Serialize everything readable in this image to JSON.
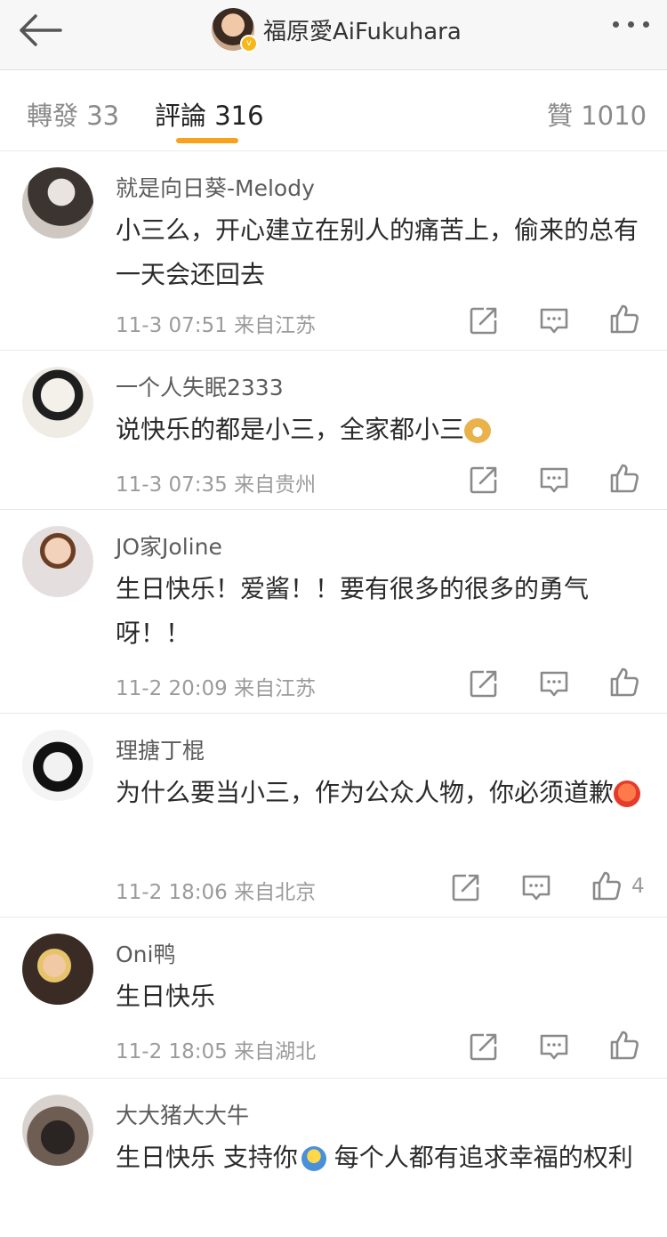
{
  "header": {
    "title": "福原愛AiFukuhara",
    "icons": {
      "back": "back-arrow-icon",
      "more": "more-dots-icon",
      "verified": "verified-badge-icon"
    }
  },
  "tabs": [
    {
      "label": "轉發 33"
    },
    {
      "label": "評論 316"
    },
    {
      "label": "贊 1010"
    }
  ],
  "accent_color": "#f7a21a",
  "comments": [
    {
      "name": "就是向日葵-Melody",
      "text": "小三么，开心建立在别人的痛苦上，偷来的总有一天会还回去",
      "time": "11-3 07:51",
      "source": "来自江苏",
      "likes": ""
    },
    {
      "name": "一个人失眠2333",
      "text": "说快乐的都是小三，全家都小三",
      "emoji": "doge-emoji",
      "time": "11-3 07:35",
      "source": "来自贵州",
      "likes": ""
    },
    {
      "name": "JO家Joline",
      "text": "生日快乐！爱酱！！要有很多的很多的勇气呀！！",
      "time": "11-2 20:09",
      "source": "来自江苏",
      "likes": ""
    },
    {
      "name": "理搪丁棍",
      "text": "为什么要当小三，作为公众人物，你必须道歉",
      "emoji": "angry-emoji",
      "time": "11-2 18:06",
      "source": "来自北京",
      "likes": "4"
    },
    {
      "name": "Oni鸭",
      "text": "生日快乐",
      "time": "11-2 18:05",
      "source": "来自湖北",
      "likes": ""
    },
    {
      "name": "大大猪大大牛",
      "text_a": "生日快乐 支持你",
      "text_b": " 每个人都有追求幸福的权利",
      "emoji": "hug-emoji"
    }
  ]
}
